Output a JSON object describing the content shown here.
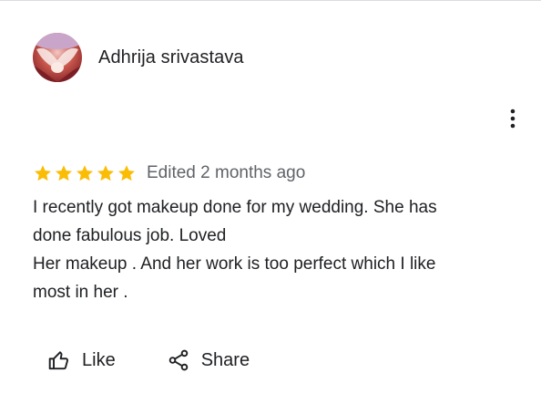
{
  "review": {
    "author": "Adhrija srivastava",
    "rating": 5,
    "rating_max": 5,
    "star_color": "#fbbc04",
    "edited": "Edited 2 months ago",
    "text_lines": [
      "I recently got makeup done for my wedding. She has",
      "done fabulous job. Loved",
      "Her makeup . And her work is too perfect which I like",
      "most in her ."
    ]
  },
  "actions": {
    "like_label": "Like",
    "like_icon": "thumbs-up-icon",
    "share_label": "Share",
    "share_icon": "share-icon",
    "more_icon": "more-vert-icon"
  }
}
